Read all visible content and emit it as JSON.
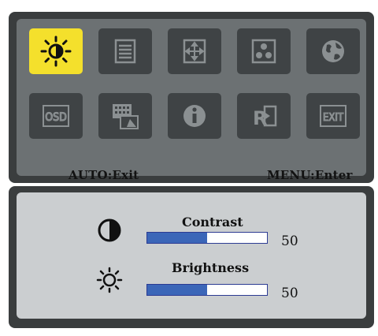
{
  "menu": {
    "icons": [
      {
        "name": "brightness-icon",
        "selected": true
      },
      {
        "name": "document-lines-icon",
        "selected": false
      },
      {
        "name": "position-arrows-icon",
        "selected": false
      },
      {
        "name": "color-dots-icon",
        "selected": false
      },
      {
        "name": "language-globe-icon",
        "selected": false
      },
      {
        "name": "osd-text-icon",
        "selected": false
      },
      {
        "name": "input-keyboard-icon",
        "selected": false
      },
      {
        "name": "information-icon",
        "selected": false
      },
      {
        "name": "reset-icon",
        "selected": false
      },
      {
        "name": "exit-icon",
        "selected": false
      }
    ],
    "osd_label": "OSD",
    "reset_label": "R",
    "exit_label": "EXIT",
    "hint_left": "AUTO:Exit",
    "hint_right": "MENU:Enter",
    "colors": {
      "selected": "#f4e02c",
      "tile": "#3f4345",
      "bar_fill": "#3b66b8"
    }
  },
  "settings": {
    "contrast": {
      "label": "Contrast",
      "value": "50",
      "level": 0.5,
      "icon": "contrast-icon"
    },
    "brightness": {
      "label": "Brightness",
      "value": "50",
      "level": 0.5,
      "icon": "sun-icon"
    }
  }
}
